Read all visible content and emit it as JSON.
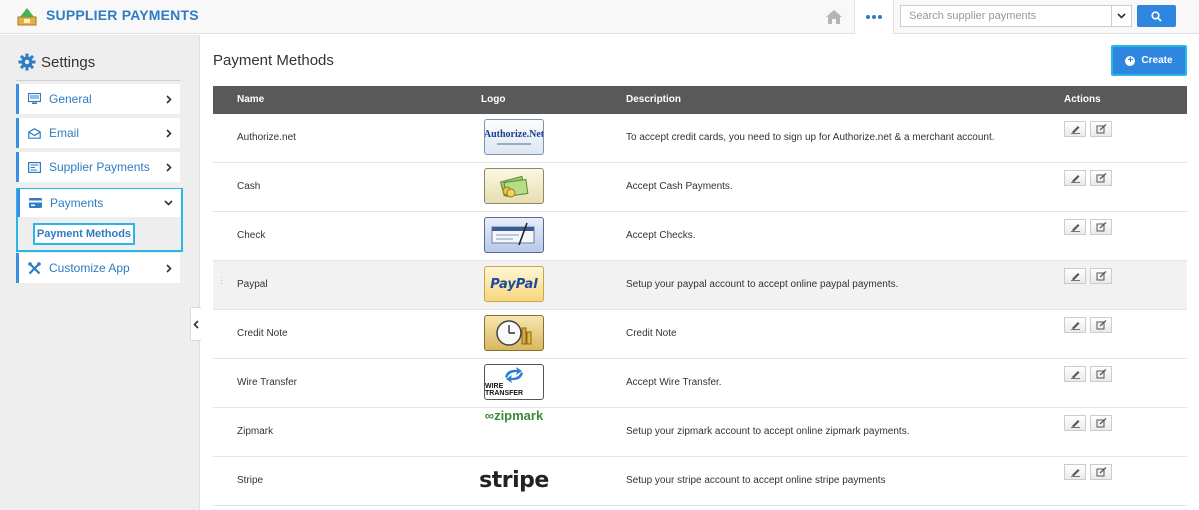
{
  "app": {
    "title": "SUPPLIER PAYMENTS"
  },
  "header": {
    "search": {
      "placeholder": "Search supplier payments",
      "value": ""
    },
    "icons": [
      "home-icon",
      "more-icon",
      "chevron-down-icon",
      "search-icon"
    ]
  },
  "sidebar": {
    "title": "Settings",
    "items": [
      {
        "label": "General",
        "icon": "monitor-icon"
      },
      {
        "label": "Email",
        "icon": "envelope-icon"
      },
      {
        "label": "Supplier Payments",
        "icon": "list-icon"
      },
      {
        "label": "Payments",
        "icon": "card-icon",
        "expanded": true
      },
      {
        "label": "Customize App",
        "icon": "tools-icon"
      }
    ],
    "sub_item": "Payment Methods"
  },
  "main": {
    "title": "Payment Methods",
    "create_label": "Create",
    "columns": [
      "Name",
      "Logo",
      "Description",
      "Actions"
    ],
    "rows": [
      {
        "name": "Authorize.net",
        "logo": "authorize-net-logo",
        "logo_text": "Authorize.Net",
        "description": "To accept credit cards, you need to sign up for Authorize.net & a merchant account."
      },
      {
        "name": "Cash",
        "logo": "cash-logo",
        "description": "Accept Cash Payments."
      },
      {
        "name": "Check",
        "logo": "check-logo",
        "description": "Accept Checks."
      },
      {
        "name": "Paypal",
        "logo": "paypal-logo",
        "logo_text": "PayPal",
        "description": "Setup your paypal account to accept online paypal payments."
      },
      {
        "name": "Credit Note",
        "logo": "credit-note-logo",
        "description": "Credit Note"
      },
      {
        "name": "Wire Transfer",
        "logo": "wire-transfer-logo",
        "logo_text": "WIRE TRANSFER",
        "description": "Accept Wire Transfer."
      },
      {
        "name": "Zipmark",
        "logo": "zipmark-logo",
        "logo_text": "zipmark",
        "description": "Setup your zipmark account to accept online zipmark payments."
      },
      {
        "name": "Stripe",
        "logo": "stripe-logo",
        "logo_text": "stripe",
        "description": "Setup your stripe account to accept online stripe payments"
      }
    ]
  },
  "colors": {
    "accent": "#2e86de",
    "highlight": "#29b6e8",
    "table_header": "#595959",
    "brand_text": "#2e7cc2"
  }
}
